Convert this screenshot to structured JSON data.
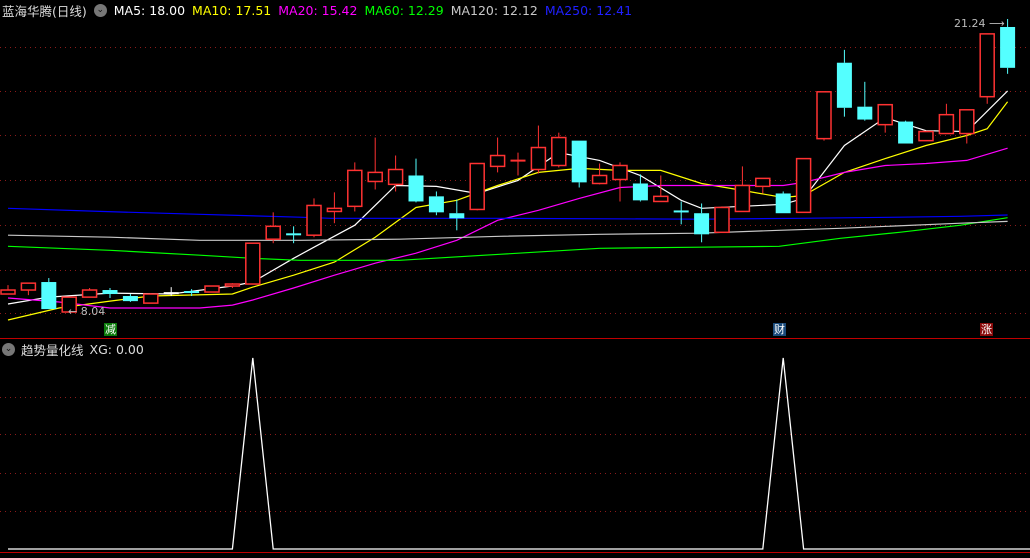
{
  "header": {
    "title": "蓝海华腾(日线)",
    "ma": [
      {
        "label": "MA5: 18.00",
        "color": "#ffffff"
      },
      {
        "label": "MA10: 17.51",
        "color": "#ffff00"
      },
      {
        "label": "MA20: 15.42",
        "color": "#ff00ff"
      },
      {
        "label": "MA60: 12.29",
        "color": "#00ff00"
      },
      {
        "label": "MA120: 12.12",
        "color": "#c8c8c8"
      },
      {
        "label": "MA250: 12.41",
        "color": "#0000ff"
      }
    ]
  },
  "indicator": {
    "title": "趋势量化线",
    "value_label": "XG: 0.00"
  },
  "annotations": {
    "low_label": "8.04",
    "high_label": "21.24",
    "tag_jian": "减",
    "tag_cai": "财",
    "tag_zhang": "涨"
  },
  "colors": {
    "up": "#ff3232",
    "down": "#54ffff",
    "flat": "#ffffff",
    "grid": "#8b1a1a",
    "separator": "#c00000"
  },
  "chart_data": [
    {
      "type": "candlestick",
      "title": "蓝海华腾(日线)",
      "ylim": [
        8.04,
        21.24
      ],
      "candles": [
        [
          8.85,
          9.25,
          8.85,
          9.03
        ],
        [
          9.03,
          9.34,
          8.8,
          9.34
        ],
        [
          9.39,
          9.57,
          8.17,
          8.17
        ],
        [
          8.04,
          8.71,
          8.04,
          8.71
        ],
        [
          8.71,
          9.12,
          8.71,
          9.03
        ],
        [
          9.03,
          9.12,
          8.67,
          8.85
        ],
        [
          8.76,
          8.85,
          8.49,
          8.53
        ],
        [
          8.44,
          8.89,
          8.44,
          8.85
        ],
        [
          8.89,
          9.16,
          8.76,
          8.89,
          "flat"
        ],
        [
          8.94,
          9.07,
          8.76,
          8.94,
          "down"
        ],
        [
          8.94,
          9.21,
          8.94,
          9.21
        ],
        [
          9.21,
          9.34,
          9.12,
          9.3
        ],
        [
          9.3,
          11.14,
          9.3,
          11.14
        ],
        [
          11.32,
          12.53,
          11.14,
          11.9
        ],
        [
          11.54,
          11.9,
          11.14,
          11.54,
          "down"
        ],
        [
          11.5,
          13.16,
          11.41,
          12.84
        ],
        [
          12.57,
          13.43,
          12.04,
          12.71
        ],
        [
          12.8,
          14.78,
          12.57,
          14.42
        ],
        [
          13.92,
          15.9,
          13.56,
          14.33
        ],
        [
          13.79,
          15.09,
          13.47,
          14.46
        ],
        [
          14.19,
          14.95,
          12.98,
          13.02
        ],
        [
          13.25,
          13.47,
          12.4,
          12.53
        ],
        [
          12.49,
          13.11,
          11.72,
          12.26
        ],
        [
          12.66,
          14.73,
          12.62,
          14.73
        ],
        [
          14.6,
          15.9,
          14.33,
          15.09
        ],
        [
          14.86,
          15.22,
          14.19,
          14.86,
          "up"
        ],
        [
          14.46,
          16.44,
          14.28,
          15.45
        ],
        [
          14.64,
          16.12,
          14.55,
          15.9
        ],
        [
          15.76,
          15.76,
          13.65,
          13.88
        ],
        [
          13.83,
          14.73,
          13.79,
          14.19
        ],
        [
          14.01,
          14.78,
          13.02,
          14.64
        ],
        [
          13.83,
          14.24,
          13.02,
          13.07
        ],
        [
          13.02,
          14.19,
          13.02,
          13.25
        ],
        [
          12.57,
          13.02,
          11.99,
          12.57,
          "down"
        ],
        [
          12.49,
          12.93,
          11.18,
          11.54
        ],
        [
          11.63,
          12.8,
          11.63,
          12.75
        ],
        [
          12.57,
          14.6,
          12.57,
          13.74
        ],
        [
          13.7,
          14.06,
          13.38,
          14.06
        ],
        [
          13.38,
          13.47,
          12.49,
          12.49
        ],
        [
          12.53,
          14.95,
          12.53,
          14.95
        ],
        [
          15.85,
          17.96,
          15.76,
          17.96
        ],
        [
          19.27,
          19.85,
          16.84,
          17.24
        ],
        [
          17.29,
          18.41,
          16.66,
          16.71
        ],
        [
          16.48,
          17.38,
          16.12,
          17.38
        ],
        [
          16.62,
          16.66,
          15.63,
          15.63
        ],
        [
          15.76,
          16.17,
          15.76,
          16.17
        ],
        [
          16.08,
          17.42,
          16.08,
          16.93
        ],
        [
          16.08,
          17.15,
          15.63,
          17.15
        ],
        [
          17.74,
          20.57,
          17.42,
          20.57
        ],
        [
          20.88,
          21.24,
          18.77,
          19.04
        ]
      ],
      "series": [
        {
          "name": "MA5",
          "color": "#ffffff",
          "points": [
            [
              0,
              8.4
            ],
            [
              2,
              8.71
            ],
            [
              5,
              8.89
            ],
            [
              8,
              8.85
            ],
            [
              11,
              9.21
            ],
            [
              12,
              9.39
            ],
            [
              14,
              10.46
            ],
            [
              15,
              10.96
            ],
            [
              17,
              11.95
            ],
            [
              19,
              13.74
            ],
            [
              21,
              13.7
            ],
            [
              23,
              13.38
            ],
            [
              25,
              13.97
            ],
            [
              27,
              15.22
            ],
            [
              29,
              14.87
            ],
            [
              31,
              14.19
            ],
            [
              33,
              13.07
            ],
            [
              34,
              12.71
            ],
            [
              36,
              12.8
            ],
            [
              38,
              12.89
            ],
            [
              39,
              13.16
            ],
            [
              41,
              15.54
            ],
            [
              43,
              16.8
            ],
            [
              45,
              16.21
            ],
            [
              47,
              16.17
            ],
            [
              49,
              18.0
            ]
          ]
        },
        {
          "name": "MA10",
          "color": "#ffff00",
          "points": [
            [
              0,
              7.68
            ],
            [
              2.5,
              8.22
            ],
            [
              5,
              8.53
            ],
            [
              7,
              8.76
            ],
            [
              11,
              8.85
            ],
            [
              12,
              9.16
            ],
            [
              14,
              9.7
            ],
            [
              16,
              10.29
            ],
            [
              18,
              11.41
            ],
            [
              20,
              12.75
            ],
            [
              22,
              13.07
            ],
            [
              24,
              13.74
            ],
            [
              26,
              14.33
            ],
            [
              28,
              14.51
            ],
            [
              30,
              14.42
            ],
            [
              32,
              14.42
            ],
            [
              34,
              13.83
            ],
            [
              36,
              13.52
            ],
            [
              38,
              13.2
            ],
            [
              39,
              13.29
            ],
            [
              41,
              14.33
            ],
            [
              43,
              14.95
            ],
            [
              45,
              15.54
            ],
            [
              47,
              15.99
            ],
            [
              48,
              16.3
            ],
            [
              49,
              17.51
            ]
          ]
        },
        {
          "name": "MA20",
          "color": "#ff00ff",
          "points": [
            [
              0,
              8.67
            ],
            [
              2.5,
              8.49
            ],
            [
              5,
              8.22
            ],
            [
              9.4,
              8.22
            ],
            [
              11,
              8.35
            ],
            [
              12,
              8.58
            ],
            [
              14,
              9.12
            ],
            [
              16,
              9.7
            ],
            [
              18,
              10.24
            ],
            [
              20,
              10.69
            ],
            [
              22,
              11.27
            ],
            [
              24,
              12.17
            ],
            [
              26,
              12.62
            ],
            [
              28,
              13.16
            ],
            [
              30,
              13.65
            ],
            [
              32,
              13.74
            ],
            [
              38,
              13.74
            ],
            [
              39,
              13.88
            ],
            [
              41,
              14.33
            ],
            [
              43,
              14.64
            ],
            [
              45,
              14.73
            ],
            [
              47,
              14.87
            ],
            [
              49,
              15.42
            ]
          ]
        },
        {
          "name": "MA60",
          "color": "#00ff00",
          "points": [
            [
              0,
              11.0
            ],
            [
              5,
              10.82
            ],
            [
              9.4,
              10.6
            ],
            [
              12,
              10.46
            ],
            [
              14.3,
              10.37
            ],
            [
              19.2,
              10.37
            ],
            [
              24.1,
              10.64
            ],
            [
              29,
              10.91
            ],
            [
              33.9,
              10.96
            ],
            [
              37.8,
              11.0
            ],
            [
              40.8,
              11.36
            ],
            [
              43.7,
              11.63
            ],
            [
              46.7,
              11.95
            ],
            [
              49,
              12.29
            ]
          ]
        },
        {
          "name": "MA120",
          "color": "#c8c8c8",
          "points": [
            [
              0,
              11.5
            ],
            [
              5,
              11.41
            ],
            [
              9.4,
              11.27
            ],
            [
              14.3,
              11.27
            ],
            [
              19.2,
              11.32
            ],
            [
              24.1,
              11.45
            ],
            [
              29,
              11.54
            ],
            [
              33.9,
              11.59
            ],
            [
              37.8,
              11.72
            ],
            [
              40.8,
              11.81
            ],
            [
              46.7,
              12.04
            ],
            [
              49,
              12.12
            ]
          ]
        },
        {
          "name": "MA250",
          "color": "#0000ff",
          "points": [
            [
              0,
              12.71
            ],
            [
              4.5,
              12.57
            ],
            [
              9.4,
              12.44
            ],
            [
              14.3,
              12.31
            ],
            [
              15.8,
              12.26
            ],
            [
              24.1,
              12.26
            ],
            [
              33.9,
              12.22
            ],
            [
              38.8,
              12.26
            ],
            [
              43.7,
              12.31
            ],
            [
              46.7,
              12.35
            ],
            [
              49,
              12.41
            ]
          ]
        }
      ]
    },
    {
      "type": "line",
      "title": "趋势量化线",
      "ylim": [
        0,
        1
      ],
      "series": [
        {
          "name": "XG",
          "color": "#ffffff",
          "values": [
            0,
            0,
            0,
            0,
            0,
            0,
            0,
            0,
            0,
            0,
            0,
            0,
            1,
            0,
            0,
            0,
            0,
            0,
            0,
            0,
            0,
            0,
            0,
            0,
            0,
            0,
            0,
            0,
            0,
            0,
            0,
            0,
            0,
            0,
            0,
            0,
            0,
            0,
            1,
            0,
            0,
            0,
            0,
            0,
            0,
            0,
            0,
            0,
            0,
            0
          ]
        }
      ]
    }
  ]
}
